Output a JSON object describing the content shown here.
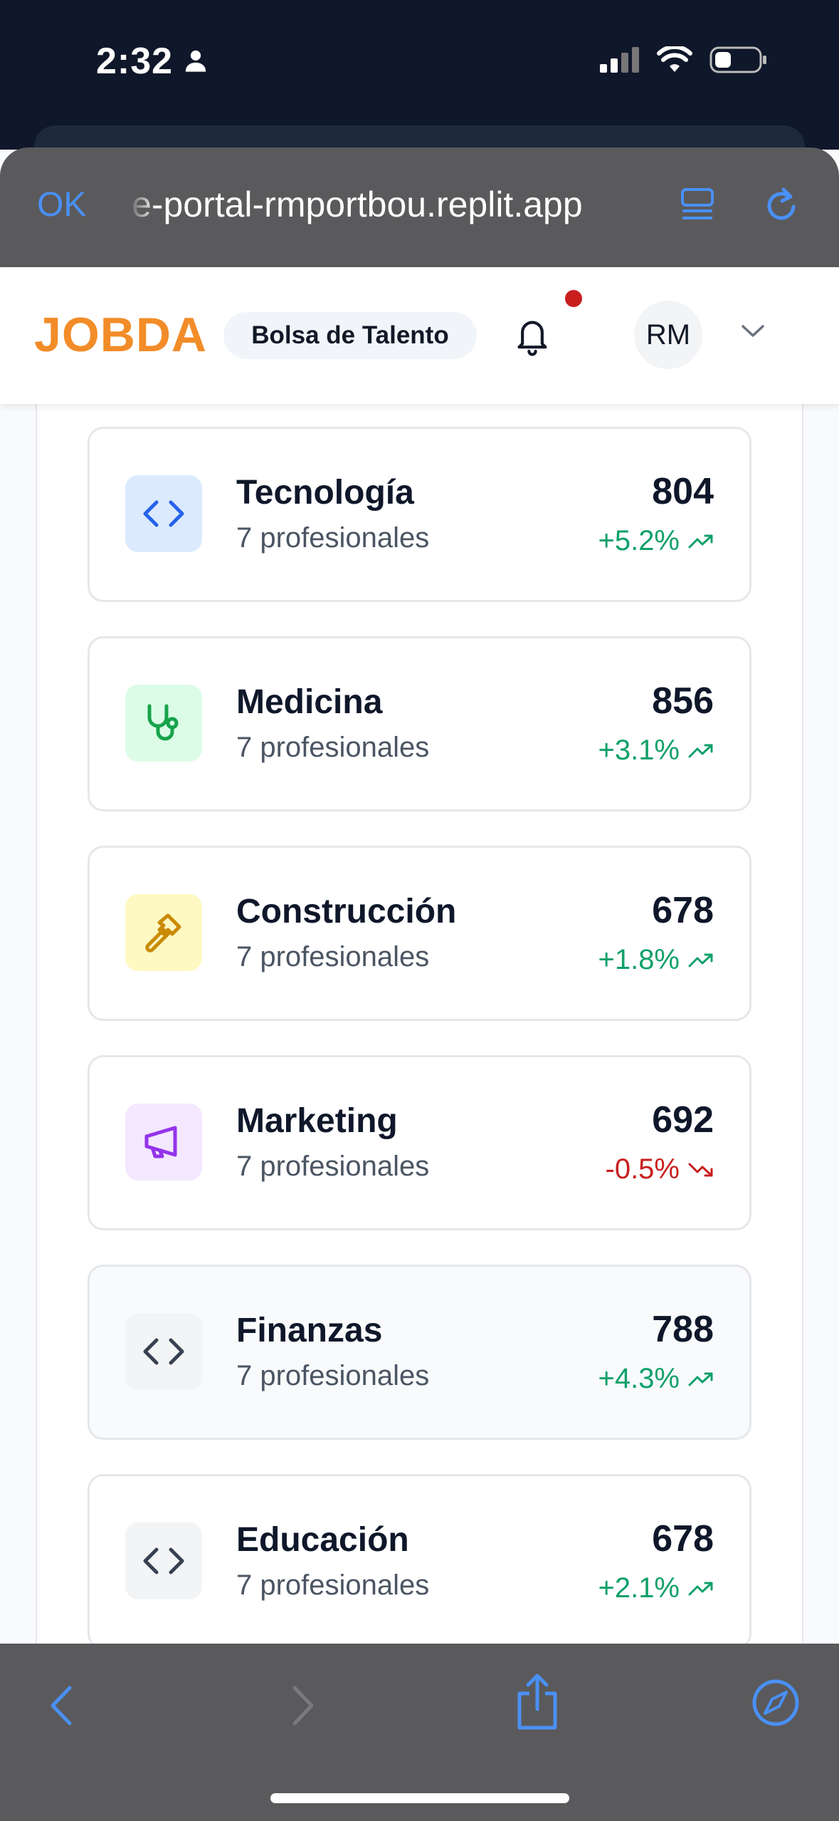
{
  "status_bar": {
    "time": "2:32"
  },
  "browser": {
    "done_label": "OK",
    "url": "e-portal-rmportbou.replit.app"
  },
  "header": {
    "logo": "JOBDA",
    "section_pill": "Bolsa de Talento",
    "avatar_initials": "RM"
  },
  "colors": {
    "brand": "#f28c28",
    "positive": "#10a06a",
    "negative": "#c81e1e",
    "ios_blue": "#4a90f5"
  },
  "categories": [
    {
      "name": "Tecnología",
      "subtitle": "7 profesionales",
      "count": "804",
      "delta": "+5.2%",
      "trend": "up",
      "icon": "code-icon",
      "icon_bg": "#dbeafe",
      "icon_color": "#2563eb"
    },
    {
      "name": "Medicina",
      "subtitle": "7 profesionales",
      "count": "856",
      "delta": "+3.1%",
      "trend": "up",
      "icon": "stethoscope-icon",
      "icon_bg": "#dcfce7",
      "icon_color": "#16a34a"
    },
    {
      "name": "Construcción",
      "subtitle": "7 profesionales",
      "count": "678",
      "delta": "+1.8%",
      "trend": "up",
      "icon": "hammer-icon",
      "icon_bg": "#fef9c3",
      "icon_color": "#ca8a04"
    },
    {
      "name": "Marketing",
      "subtitle": "7 profesionales",
      "count": "692",
      "delta": "-0.5%",
      "trend": "down",
      "icon": "megaphone-icon",
      "icon_bg": "#f3e8ff",
      "icon_color": "#9333ea"
    },
    {
      "name": "Finanzas",
      "subtitle": "7 profesionales",
      "count": "788",
      "delta": "+4.3%",
      "trend": "up",
      "icon": "code-icon",
      "icon_bg": "#f3f4f6",
      "icon_color": "#374151"
    },
    {
      "name": "Educación",
      "subtitle": "7 profesionales",
      "count": "678",
      "delta": "+2.1%",
      "trend": "up",
      "icon": "code-icon",
      "icon_bg": "#f3f4f6",
      "icon_color": "#374151"
    }
  ]
}
